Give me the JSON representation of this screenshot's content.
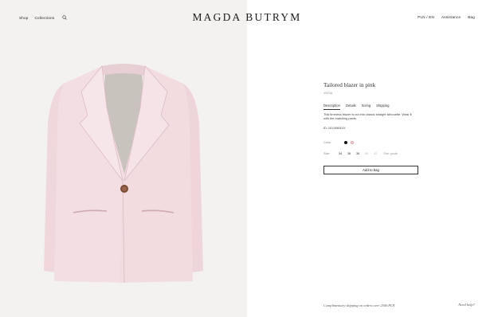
{
  "header": {
    "nav_left": {
      "shop": "Shop",
      "collections": "Collections"
    },
    "logo": "MAGDA BUTRYM",
    "nav_right": {
      "language": "PLN / EN",
      "assistance": "Assistance",
      "bag": "Bag"
    }
  },
  "product": {
    "title": "Tailored blazer in pink",
    "price": "4900zł",
    "tabs": [
      "Description",
      "Details",
      "Sizing",
      "Shipping"
    ],
    "active_tab": "Description",
    "description": "This timeless blazer is cut into classic straight silhouette. Wear it with the matching pants.",
    "id": "ID: 16115964VX",
    "color_label": "Color",
    "colors": [
      {
        "name": "black",
        "hex": "#111111",
        "selected": false
      },
      {
        "name": "pink",
        "hex": "#f1d3d8",
        "selected": true
      }
    ],
    "size_label": "Size",
    "sizes": [
      {
        "label": "34",
        "available": true
      },
      {
        "label": "36",
        "available": true
      },
      {
        "label": "38",
        "available": true
      },
      {
        "label": "40",
        "available": false
      },
      {
        "label": "42",
        "available": false
      }
    ],
    "size_guide": "Size guide",
    "add_to_bag": "Add to bag"
  },
  "footer": {
    "shipping_note": "Complimentary shipping on orders over 2500 PLN",
    "need_help": "Need help?"
  },
  "colors": {
    "left_panel_bg": "#f3f2f0",
    "blazer_pink": "#f2dde1",
    "text": "#222222"
  }
}
